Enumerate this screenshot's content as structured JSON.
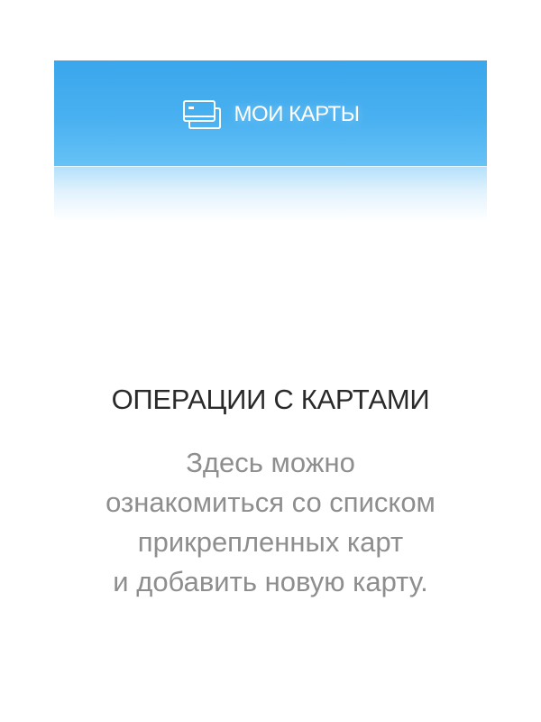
{
  "banner": {
    "icon": "cards-icon",
    "label": "МОИ КАРТЫ"
  },
  "section": {
    "title": "ОПЕРАЦИИ С КАРТАМИ",
    "description_lines": [
      "Здесь можно",
      "ознакомиться со списком",
      "прикрепленных карт",
      "и добавить новую карту."
    ]
  },
  "colors": {
    "banner_top": "#3aa6ec",
    "banner_bottom": "#67c2f6",
    "title_text": "#2a2a2a",
    "description_text": "#8e8e8e"
  }
}
